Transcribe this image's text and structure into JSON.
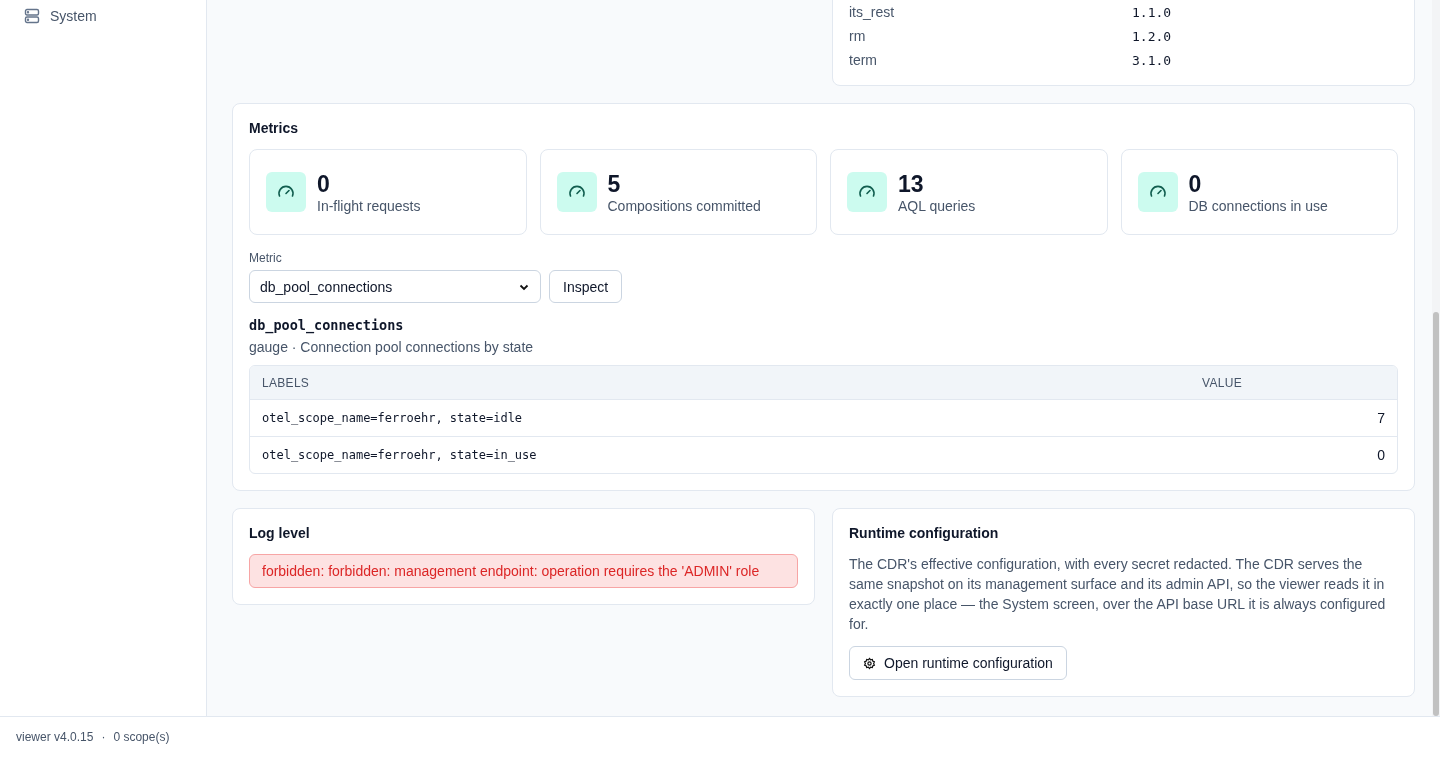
{
  "sidebar": {
    "items": [
      {
        "label": "System",
        "selected": false
      }
    ]
  },
  "versions": {
    "rows": [
      {
        "name": "its_rest",
        "version": "1.1.0"
      },
      {
        "name": "rm",
        "version": "1.2.0"
      },
      {
        "name": "term",
        "version": "3.1.0"
      }
    ]
  },
  "metrics": {
    "title": "Metrics",
    "stats": [
      {
        "value": "0",
        "label": "In-flight requests"
      },
      {
        "value": "5",
        "label": "Compositions committed"
      },
      {
        "value": "13",
        "label": "AQL queries"
      },
      {
        "value": "0",
        "label": "DB connections in use"
      }
    ],
    "metric_label": "Metric",
    "metric_value": "db_pool_connections",
    "inspect_button": "Inspect",
    "detail_name": "db_pool_connections",
    "detail_description": "gauge · Connection pool connections by state",
    "table": {
      "columns": [
        "LABELS",
        "VALUE"
      ],
      "rows": [
        {
          "labels": "otel_scope_name=ferroehr, state=idle",
          "value": "7"
        },
        {
          "labels": "otel_scope_name=ferroehr, state=in_use",
          "value": "0"
        }
      ]
    }
  },
  "log_level": {
    "title": "Log level",
    "error": "forbidden: forbidden: management endpoint: operation requires the 'ADMIN' role"
  },
  "runtime": {
    "title": "Runtime configuration",
    "description": "The CDR's effective configuration, with every secret redacted. The CDR serves the same snapshot on its management surface and its admin API, so the viewer reads it in exactly one place — the System screen, over the API base URL it is always configured for.",
    "button": "Open runtime configuration"
  },
  "status_bar": {
    "version": "viewer v4.0.15",
    "separator": "·",
    "scopes": "0 scope(s)"
  }
}
